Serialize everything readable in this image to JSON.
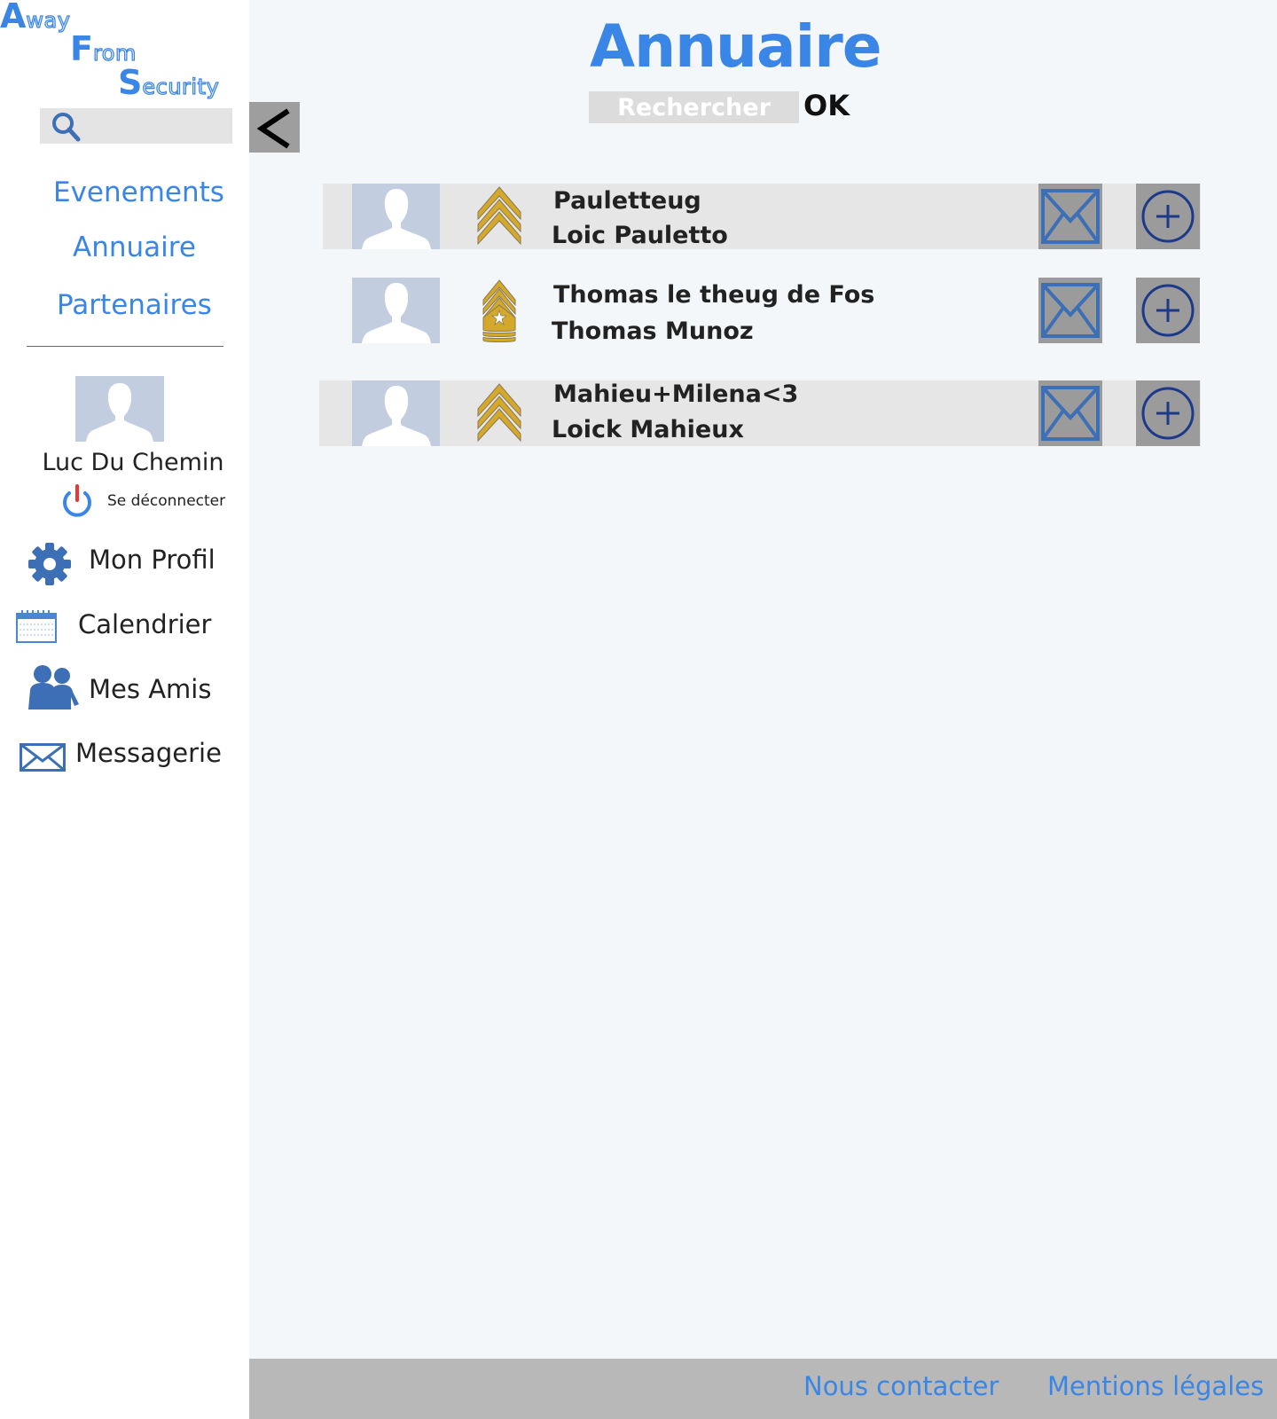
{
  "logo": {
    "line1_cap": "A",
    "line1_rest": "way",
    "line2_cap": "F",
    "line2_rest": "rom",
    "line3_cap": "S",
    "line3_rest": "ecurity"
  },
  "sidebar": {
    "nav": [
      {
        "label": "Evenements"
      },
      {
        "label": "Annuaire"
      },
      {
        "label": "Partenaires"
      }
    ],
    "user": {
      "name": "Luc Du Chemin",
      "logout_label": "Se déconnecter"
    },
    "menu": [
      {
        "label": "Mon Profil",
        "icon": "gear-icon"
      },
      {
        "label": "Calendrier",
        "icon": "calendar-icon"
      },
      {
        "label": "Mes Amis",
        "icon": "friends-icon"
      },
      {
        "label": "Messagerie",
        "icon": "envelope-icon"
      }
    ]
  },
  "header": {
    "title": "Annuaire",
    "search_placeholder": "Rechercher",
    "ok_label": "OK"
  },
  "directory": [
    {
      "handle": "Pauletteug",
      "full_name": "Loic Pauletto",
      "rank_icon": "sergeant-chevron-icon"
    },
    {
      "handle": "Thomas le theug de Fos",
      "full_name": "Thomas Munoz",
      "rank_icon": "master-sergeant-icon"
    },
    {
      "handle": "Mahieu+Milena<3",
      "full_name": "Loick Mahieux",
      "rank_icon": "sergeant-chevron-icon"
    }
  ],
  "footer": {
    "contact_label": "Nous contacter",
    "legal_label": "Mentions légales"
  },
  "colors": {
    "accent": "#3a86e6",
    "icon_blue": "#3d6fb6",
    "row_shade": "#e6e6e6",
    "button_gray": "#9b9b9b",
    "footer_gray": "#b8b8b8",
    "rank_gold": "#d4a82a"
  }
}
